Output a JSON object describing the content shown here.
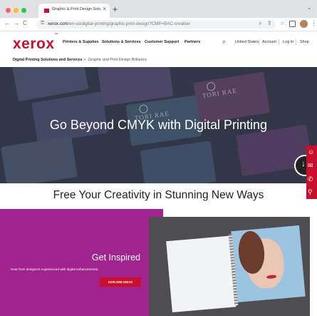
{
  "browser": {
    "tab_title": "Graphic & Print Design Soluti",
    "tab_close": "×",
    "new_tab": "+",
    "tab_menu_caret": "⌄",
    "back": "←",
    "forward": "→",
    "reload": "C",
    "lock": "🔒",
    "url_host": "xerox.com",
    "url_path": "/en-us/digital-printing/graphic-print-design?CMP=BAC-creative",
    "menu": "⋮",
    "icons": [
      "search-icon",
      "share-icon",
      "star-icon",
      "extensions-icon",
      "profile-avatar",
      "menu-icon"
    ]
  },
  "site": {
    "logo": "xerox",
    "logo_tm": "™",
    "nav": [
      "Printers & Supplies",
      "Solutions & Services",
      "Customer Support",
      "Partners"
    ],
    "search_glyph": "⌕",
    "utility": [
      "United States",
      "Account",
      "Log In",
      "Shop"
    ]
  },
  "breadcrumb": [
    "Digital Printing Solutions and Services",
    ">",
    "Graphic and Print Design Brilliance"
  ],
  "hero": {
    "title": "Go Beyond CMYK with Digital Printing",
    "card_text": "TORI RAE",
    "circle_glyph": "↓"
  },
  "side_rail": {
    "icons": [
      "chat-icon",
      "mail-icon",
      "phone-icon",
      "location-icon"
    ],
    "glyphs": [
      "☺",
      "✉",
      "✆",
      "⚲"
    ]
  },
  "subheading": "Free Your Creativity in Stunning New Ways",
  "promo": {
    "title": "Get Inspired",
    "text": "Hear from designers experienced with digital enhancements.",
    "button": "EXPLORE IDEAS"
  },
  "colors": {
    "brand_red": "#c8102e",
    "promo_purple": "#a0238e",
    "hero_overlay": "#3b4152"
  }
}
